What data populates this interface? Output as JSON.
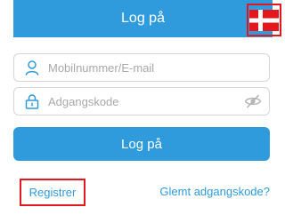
{
  "header": {
    "title": "Log på",
    "language_icon": "denmark-flag-icon"
  },
  "form": {
    "username": {
      "placeholder": "Mobilnummer/E-mail",
      "value": "",
      "icon": "user-icon"
    },
    "password": {
      "placeholder": "Adgangskode",
      "value": "",
      "icon": "lock-icon",
      "toggle_icon": "eye-hidden-icon"
    },
    "login_button_label": "Log på"
  },
  "links": {
    "register": "Registrer",
    "forgot_password": "Glemt adgangskode?"
  },
  "colors": {
    "primary": "#2F9BDD",
    "highlight": "#E3171C",
    "flag_red": "#E3171C",
    "flag_white": "#ffffff"
  }
}
